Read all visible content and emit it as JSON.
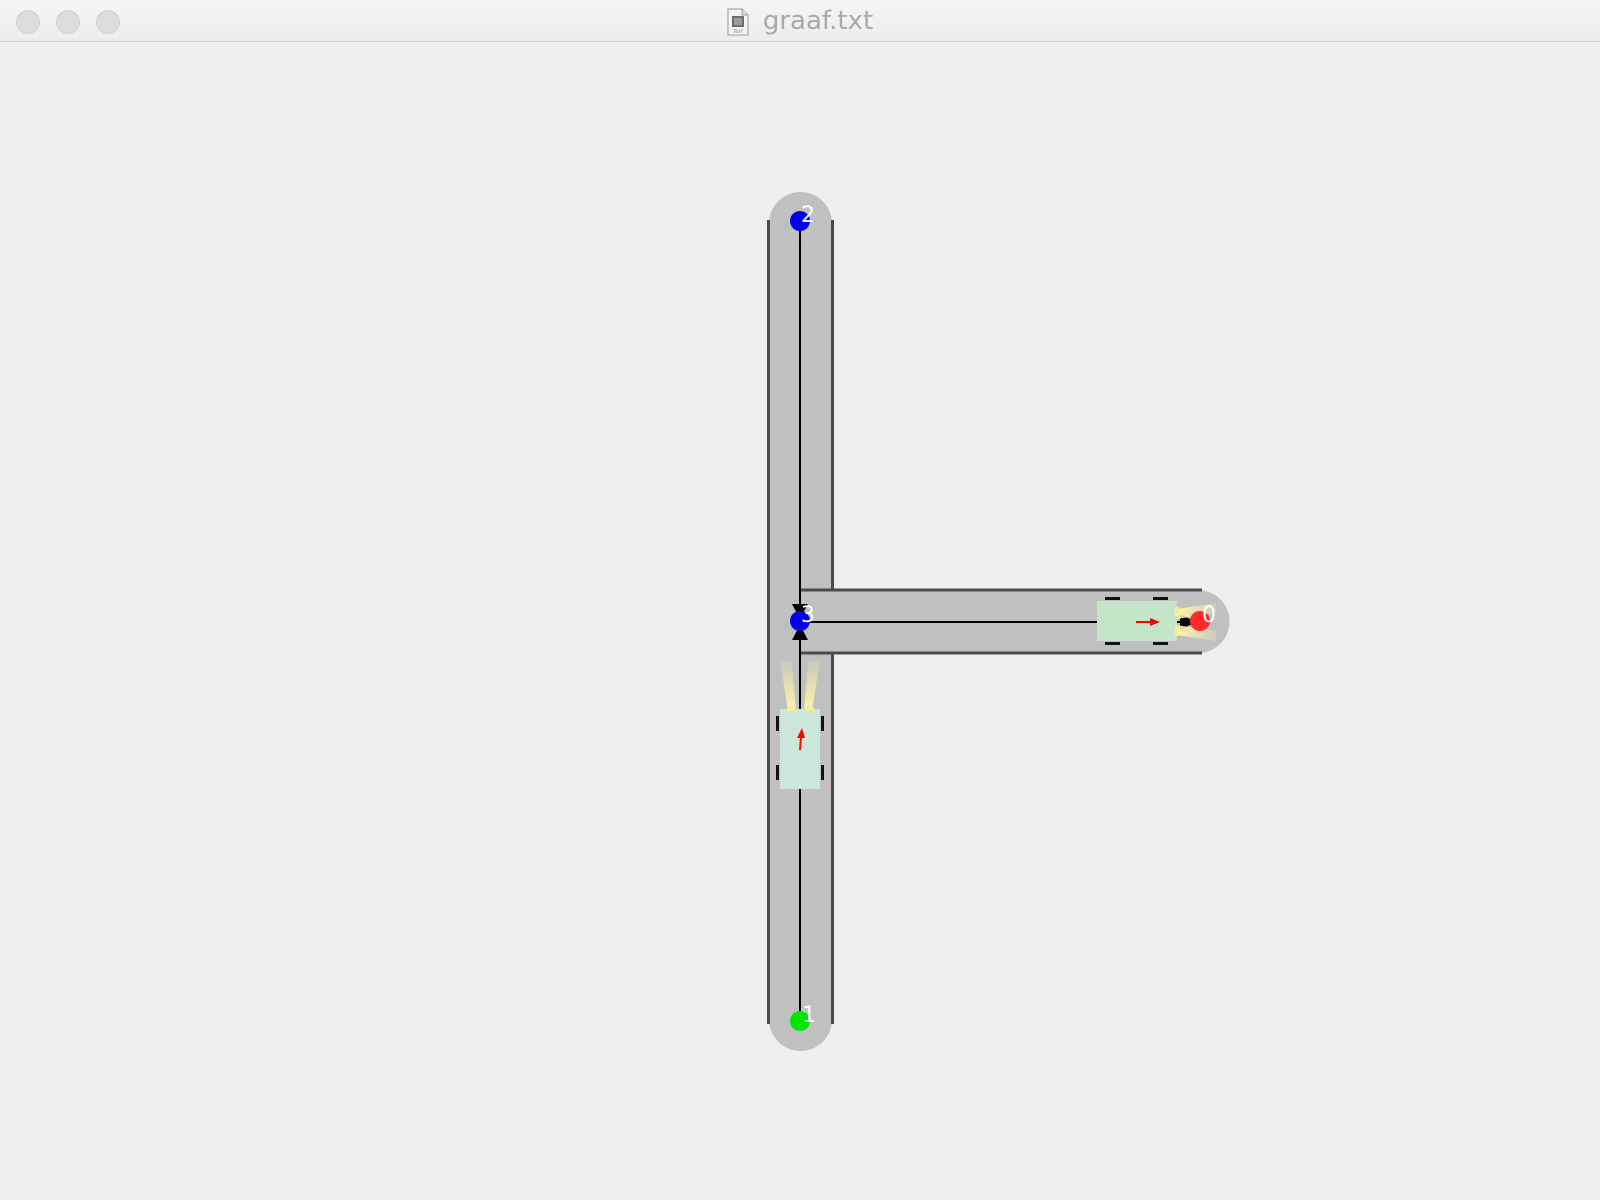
{
  "window": {
    "title": "graaf.txt",
    "title_icon": "text-document-icon",
    "controls": [
      {
        "name": "close-button",
        "icon": "circle"
      },
      {
        "name": "minimize-button",
        "icon": "circle"
      },
      {
        "name": "zoom-button",
        "icon": "circle"
      }
    ]
  },
  "graph": {
    "nodes": [
      {
        "id": "0",
        "label": "0",
        "color": "#ff2a2a"
      },
      {
        "id": "1",
        "label": "1",
        "color": "#00e600"
      },
      {
        "id": "2",
        "label": "2",
        "color": "#0000ee"
      },
      {
        "id": "3",
        "label": "3",
        "color": "#0000ee"
      }
    ],
    "edges": [
      {
        "from": "2",
        "to": "3"
      },
      {
        "from": "1",
        "to": "3"
      },
      {
        "from": "3",
        "to": "0"
      }
    ],
    "vehicles": [
      {
        "id": "car-vertical",
        "heading": "north",
        "body_color": "#cce6dc"
      },
      {
        "id": "car-horizontal",
        "heading": "east",
        "body_color": "#c4e6c8"
      }
    ]
  },
  "colors": {
    "background": "#efefef",
    "road": "#c0c0c0",
    "road_edge": "#4a4a4a",
    "lane_line": "#000000",
    "headlight": "#fff7a8",
    "direction_arrow": "#ff0000",
    "label": "#ffffff"
  }
}
